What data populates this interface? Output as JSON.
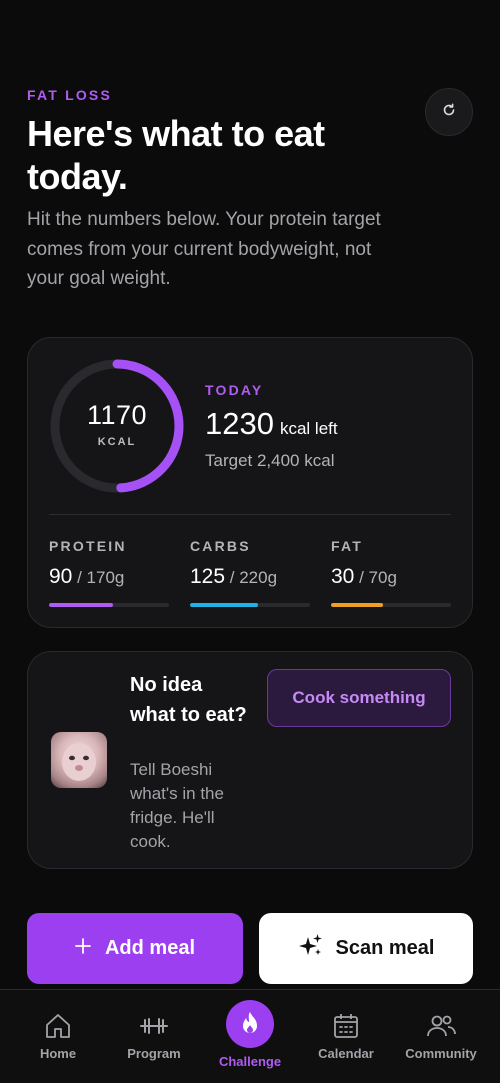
{
  "header": {
    "eyebrow": "FAT LOSS",
    "title": "Here's what to eat today.",
    "subtitle": "Hit the numbers below. Your protein target comes from your current bodyweight, not your goal weight.",
    "refresh_icon": "refresh-icon"
  },
  "summary": {
    "ring_value": "1170",
    "ring_unit": "KCAL",
    "ring_progress": 0.49,
    "today_label": "TODAY",
    "kcal_left": "1230",
    "kcal_left_unit": "kcal left",
    "target": "Target 2,400 kcal",
    "macros": [
      {
        "label": "PROTEIN",
        "value": "90",
        "goal": "170g",
        "progress": 0.53,
        "color": "#b05cf2"
      },
      {
        "label": "CARBS",
        "value": "125",
        "goal": "220g",
        "progress": 0.57,
        "color": "#22b3e6"
      },
      {
        "label": "FAT",
        "value": "30",
        "goal": "70g",
        "progress": 0.43,
        "color": "#f0a020"
      }
    ]
  },
  "cook": {
    "title": "No idea what to eat?",
    "subtitle": "Tell Boeshi what's in the fridge. He'll cook.",
    "button": "Cook something"
  },
  "actions": {
    "add_meal": "Add meal",
    "scan_meal": "Scan meal"
  },
  "tabs": [
    {
      "label": "Home",
      "icon": "home-icon"
    },
    {
      "label": "Program",
      "icon": "dumbbell-icon"
    },
    {
      "label": "Challenge",
      "icon": "flame-icon",
      "active": true
    },
    {
      "label": "Calendar",
      "icon": "calendar-icon"
    },
    {
      "label": "Community",
      "icon": "people-icon"
    }
  ],
  "colors": {
    "accent": "#9b3ff0",
    "accent_text": "#b05cf2",
    "background": "#0b0b0c",
    "card": "#151517"
  }
}
